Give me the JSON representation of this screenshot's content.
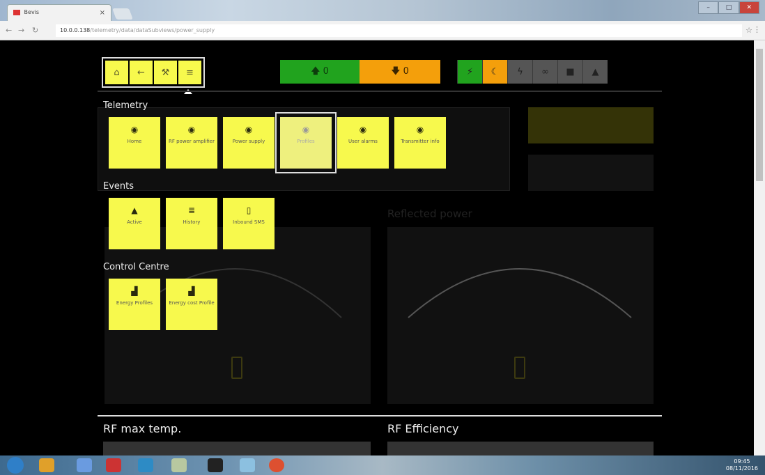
{
  "browser": {
    "tab_title": "Bevis",
    "tab_close": "×",
    "url_host": "10.0.0.138",
    "url_path": "/telemetry/data/dataSubviews/power_supply",
    "window_controls": [
      "–",
      "□",
      "✕"
    ]
  },
  "topbar": {
    "nav_icons": [
      "home-icon",
      "back-icon",
      "wrench-icon",
      "menu-icon"
    ],
    "up_count": "0",
    "down_count": "0",
    "status_icons": [
      "plug-icon",
      "moon-icon",
      "bolt-icon",
      "link-icon",
      "lock-icon",
      "warning-icon"
    ],
    "colors": {
      "green": "#21a31e",
      "orange": "#f49f0b",
      "yellow": "#f7f94d"
    }
  },
  "sections": {
    "telemetry": "Telemetry",
    "events": "Events",
    "control_centre": "Control Centre"
  },
  "telemetry_tiles": [
    {
      "icon": "gauge-icon",
      "label": "Home"
    },
    {
      "icon": "gauge-icon",
      "label": "RF power amplifier"
    },
    {
      "icon": "gauge-icon",
      "label": "Power supply"
    },
    {
      "icon": "gauge-icon",
      "label": "Profiles"
    },
    {
      "icon": "gauge-icon",
      "label": "User alarms"
    },
    {
      "icon": "gauge-icon",
      "label": "Transmitter info"
    }
  ],
  "event_tiles": [
    {
      "icon": "warning-icon",
      "label": "Active"
    },
    {
      "icon": "list-icon",
      "label": "History"
    },
    {
      "icon": "phone-icon",
      "label": "Inbound SMS"
    }
  ],
  "control_tiles": [
    {
      "icon": "bar-chart-icon",
      "label": "Energy Profiles"
    },
    {
      "icon": "bar-chart-icon",
      "label": "Energy cost Profile"
    }
  ],
  "background": {
    "reflected_power": "Reflected power",
    "rf_max_temp": "RF max temp.",
    "rf_efficiency": "RF Efficiency"
  },
  "taskbar": {
    "time": "09:45",
    "date": "08/11/2016"
  }
}
